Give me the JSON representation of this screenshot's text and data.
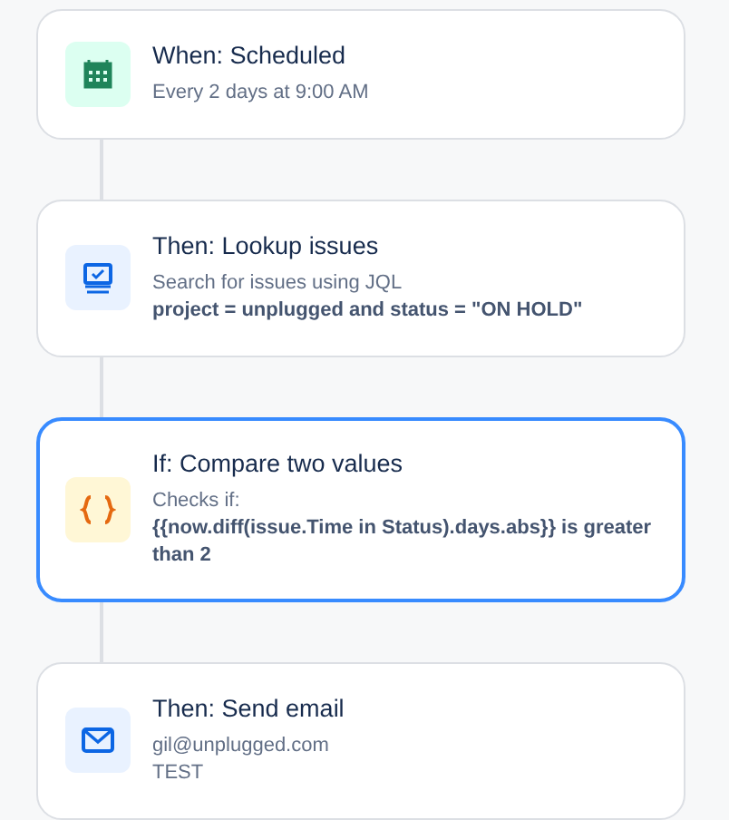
{
  "steps": [
    {
      "kind": "calendar",
      "title": "When: Scheduled",
      "selected": false,
      "lines": [
        {
          "text": "Every 2 days at 9:00 AM",
          "bold": false
        }
      ]
    },
    {
      "kind": "monitor",
      "title": "Then: Lookup issues",
      "selected": false,
      "lines": [
        {
          "text": "Search for issues using JQL",
          "bold": false
        },
        {
          "text": "project = unplugged and status = \"ON HOLD\"",
          "bold": true
        }
      ]
    },
    {
      "kind": "braces",
      "title": "If: Compare two values",
      "selected": true,
      "lines": [
        {
          "text": "Checks if:",
          "bold": false
        },
        {
          "text": "{{now.diff(issue.Time in Status).days.abs}} is greater than 2",
          "bold": true
        }
      ]
    },
    {
      "kind": "mail",
      "title": "Then: Send email",
      "selected": false,
      "lines": [
        {
          "text": "gil@unplugged.com",
          "bold": false
        },
        {
          "text": "TEST",
          "bold": false
        }
      ]
    }
  ]
}
